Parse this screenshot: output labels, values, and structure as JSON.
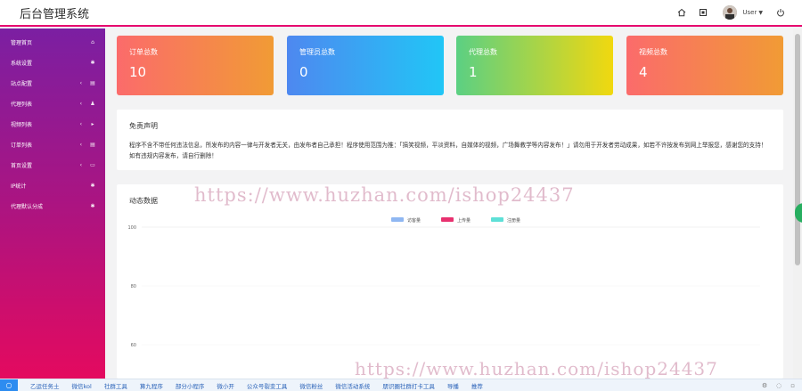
{
  "header": {
    "title": "后台管理系统",
    "user_label": "User",
    "icons": [
      "home-icon",
      "fullscreen-icon",
      "power-icon"
    ]
  },
  "sidebar": {
    "items": [
      {
        "label": "管理首页",
        "icon": "home-icon",
        "arrow": ""
      },
      {
        "label": "系统设置",
        "icon": "gear-icon",
        "arrow": ""
      },
      {
        "label": "站点配置",
        "icon": "list-icon",
        "arrow": "‹"
      },
      {
        "label": "代理列表",
        "icon": "user-icon",
        "arrow": "‹"
      },
      {
        "label": "视频列表",
        "icon": "play-icon",
        "arrow": "‹"
      },
      {
        "label": "订单列表",
        "icon": "list-icon",
        "arrow": "‹"
      },
      {
        "label": "首页设置",
        "icon": "monitor-icon",
        "arrow": "‹"
      },
      {
        "label": "IP统计",
        "icon": "gear-icon",
        "arrow": ""
      },
      {
        "label": "代理默认分成",
        "icon": "gear-icon",
        "arrow": ""
      }
    ]
  },
  "stats": [
    {
      "title": "订单总数",
      "value": "10"
    },
    {
      "title": "管理员总数",
      "value": "0"
    },
    {
      "title": "代理总数",
      "value": "1"
    },
    {
      "title": "视频总数",
      "value": "4"
    }
  ],
  "notice": {
    "title": "免责声明",
    "text": "程序不含不带任何违法信息，所发布的内容一律与开发者无关，由发布者自己承担！程序使用范围为推：「搞笑视频，平淡资料，自媒体的视频，广场舞教学等内容发布！」请勿用于开发者劳动成果，如若不许按发布到网上举报您，感谢您的支持！如有违规内容发布，请自行删除！"
  },
  "chart_panel": {
    "title": "动态数据"
  },
  "chart_data": {
    "type": "line",
    "series": [
      {
        "name": "访客量",
        "color": "#8fb7f2",
        "values": []
      },
      {
        "name": "上传量",
        "color": "#e8316f",
        "values": []
      },
      {
        "name": "注册量",
        "color": "#5ee0d7",
        "values": []
      }
    ],
    "y_ticks": [
      "100",
      "80",
      "60"
    ],
    "ylim": [
      60,
      100
    ],
    "legend": "top-center",
    "grid": true
  },
  "watermark": "https://www.huzhan.com/ishop24437",
  "bottombar": {
    "links": [
      "乙运任务土",
      "微信kol",
      "社群工具",
      "算九程序",
      "部分小程序",
      "微小开",
      "公众号裂变工具",
      "微信粉丝",
      "微信活动系统",
      "朋识圈社群打卡工具",
      "导播",
      "推荐"
    ],
    "start_icon": "circle-icon"
  }
}
